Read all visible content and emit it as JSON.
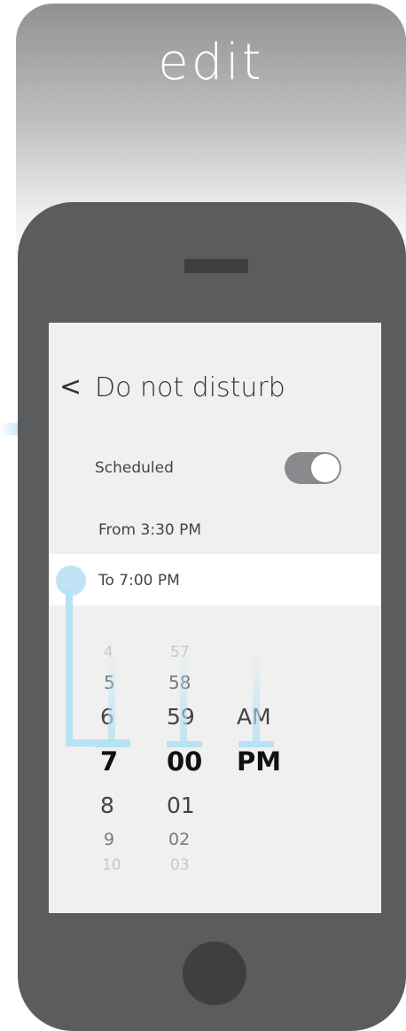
{
  "header": {
    "title": "edit"
  },
  "screen": {
    "back_icon": "<",
    "title": "Do not disturb",
    "scheduled_label": "Scheduled",
    "scheduled_on": true,
    "from_label": "From 3:30 PM",
    "to_label": "To 7:00 PM"
  },
  "picker": {
    "hours": [
      "4",
      "5",
      "6",
      "7",
      "8",
      "9",
      "10"
    ],
    "minutes": [
      "57",
      "58",
      "59",
      "00",
      "01",
      "02",
      "03"
    ],
    "ampm": [
      "AM",
      "PM"
    ],
    "selected": {
      "hour": "7",
      "minute": "00",
      "ampm": "PM"
    }
  },
  "colors": {
    "phone_body": "#5b5c5e",
    "screen_bg": "#f0f0f0",
    "highlight": "#b8e1f4",
    "toggle_track": "#888a8d"
  }
}
